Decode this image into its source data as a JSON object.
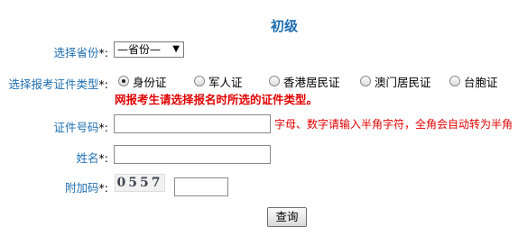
{
  "form": {
    "title": "初级",
    "province": {
      "label": "选择省份",
      "required": "*:",
      "selected": "—省份—"
    },
    "id_type": {
      "label": "选择报考证件类型",
      "required": "*:",
      "options": [
        "身份证",
        "军人证",
        "香港居民证",
        "澳门居民证",
        "台胞证"
      ],
      "selected_index": 0,
      "notice": "网报考生请选择报名时所选的证件类型。"
    },
    "id_number": {
      "label": "证件号码",
      "required": "*:",
      "value": "",
      "hint": "字母、数字请输入半角字符，全角会自动转为半角"
    },
    "name": {
      "label": "姓名",
      "required": "*:",
      "value": ""
    },
    "captcha": {
      "label": "附加码",
      "required": "*:",
      "image_text": "0557",
      "value": ""
    },
    "submit_label": "查询"
  }
}
